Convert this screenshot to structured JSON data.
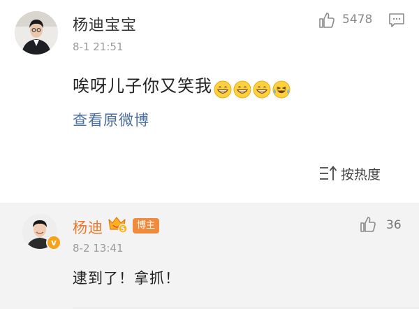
{
  "comment": {
    "username": "杨迪宝宝",
    "time": "8-1 21:51",
    "like_count": "5478",
    "text": "唉呀儿子你又笑我",
    "emojis": [
      "grin-emoji",
      "grin-emoji",
      "grin-emoji",
      "laugh-tears-emoji"
    ],
    "view_original": "查看原微博"
  },
  "sort": {
    "label": "按热度"
  },
  "reply": {
    "username": "杨迪",
    "host_badge": "博主",
    "member_level": "5",
    "verified_mark": "v",
    "time": "8-2 13:41",
    "like_count": "36",
    "text": "逮到了！拿抓！"
  },
  "colors": {
    "link": "#4a6e9f",
    "reply_name": "#e8782e",
    "host_badge_bg": "#f08a3c",
    "reply_bg": "#f3f3f3"
  }
}
